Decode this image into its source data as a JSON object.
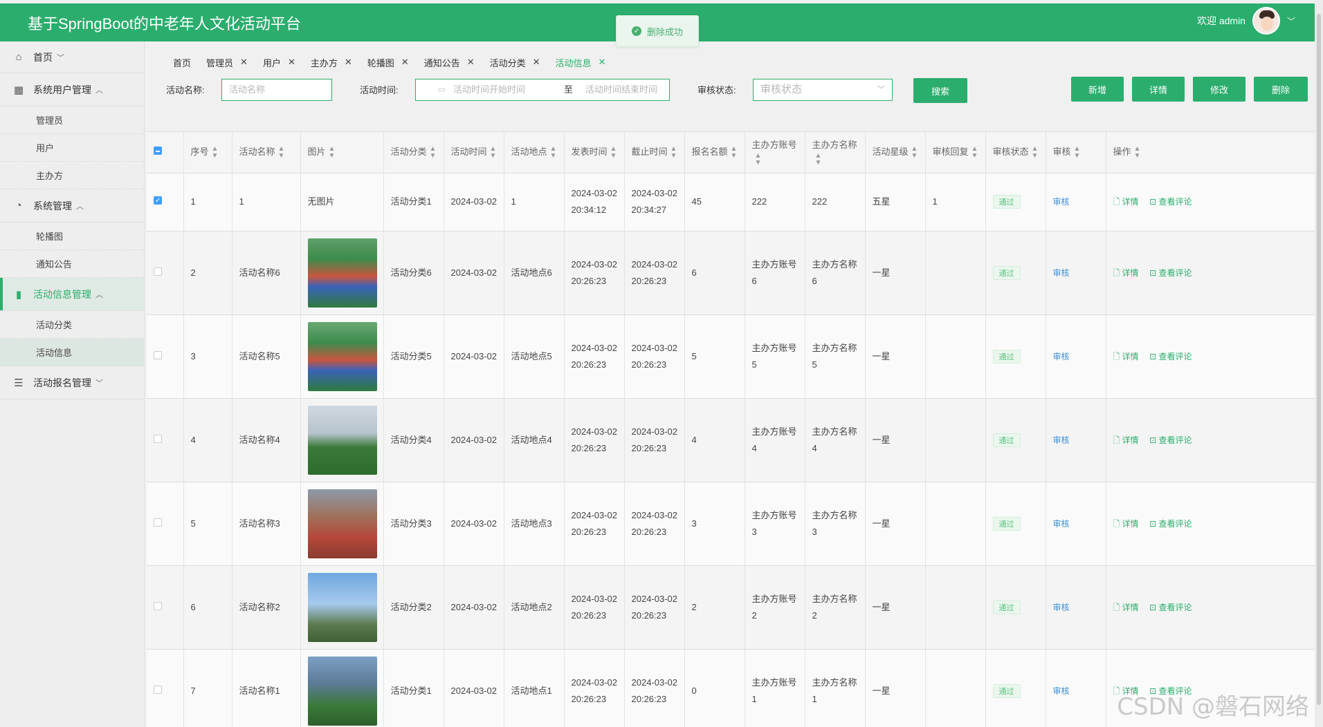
{
  "header": {
    "title": "基于SpringBoot的中老年人文化活动平台",
    "welcome": "欢迎 admin",
    "toast": "删除成功"
  },
  "sidebar": {
    "groups": [
      {
        "label": "首页",
        "icon": "home-icon"
      },
      {
        "label": "系统用户管理",
        "icon": "grid-icon",
        "items": [
          "管理员",
          "用户",
          "主办方"
        ]
      },
      {
        "label": "系统管理",
        "icon": "gauge-icon",
        "items": [
          "轮播图",
          "通知公告"
        ]
      },
      {
        "label": "活动信息管理",
        "icon": "folder-icon",
        "items": [
          "活动分类",
          "活动信息"
        ]
      },
      {
        "label": "活动报名管理",
        "icon": "server-icon"
      }
    ]
  },
  "tabs": [
    "首页",
    "管理员",
    "用户",
    "主办方",
    "轮播图",
    "通知公告",
    "活动分类",
    "活动信息"
  ],
  "filter": {
    "name_label": "活动名称:",
    "name_placeholder": "活动名称",
    "time_label": "活动时间:",
    "time_start_placeholder": "活动时间开始时间",
    "time_sep": "至",
    "time_end_placeholder": "活动时间结束时间",
    "status_label": "审核状态:",
    "status_placeholder": "审核状态",
    "search_btn": "搜索"
  },
  "actions": {
    "add": "新增",
    "detail": "详情",
    "edit": "修改",
    "delete": "删除"
  },
  "table": {
    "columns": [
      "序号",
      "活动名称",
      "图片",
      "活动分类",
      "活动时间",
      "活动地点",
      "发表时间",
      "截止时间",
      "报名名额",
      "主办方账号",
      "主办方名称",
      "活动星级",
      "审核回复",
      "审核状态",
      "审核",
      "操作"
    ],
    "audit_link": "审核",
    "op_detail": "详情",
    "op_comment": "查看评论",
    "rows": [
      {
        "no": "1",
        "name": "1",
        "image": "无图片",
        "category": "活动分类1",
        "time": "2024-03-02",
        "place": "1",
        "publish": "2024-03-02 20:34:12",
        "deadline": "2024-03-02 20:34:27",
        "quota": "45",
        "org_acc": "222",
        "org_name": "222",
        "stars": "五星",
        "reply": "1",
        "status": "通过"
      },
      {
        "no": "2",
        "name": "活动名称6",
        "image": "",
        "category": "活动分类6",
        "time": "2024-03-02",
        "place": "活动地点6",
        "publish": "2024-03-02 20:26:23",
        "deadline": "2024-03-02 20:26:23",
        "quota": "6",
        "org_acc": "主办方账号6",
        "org_name": "主办方名称6",
        "stars": "一星",
        "reply": "",
        "status": "通过"
      },
      {
        "no": "3",
        "name": "活动名称5",
        "image": "",
        "category": "活动分类5",
        "time": "2024-03-02",
        "place": "活动地点5",
        "publish": "2024-03-02 20:26:23",
        "deadline": "2024-03-02 20:26:23",
        "quota": "5",
        "org_acc": "主办方账号5",
        "org_name": "主办方名称5",
        "stars": "一星",
        "reply": "",
        "status": "通过"
      },
      {
        "no": "4",
        "name": "活动名称4",
        "image": "",
        "category": "活动分类4",
        "time": "2024-03-02",
        "place": "活动地点4",
        "publish": "2024-03-02 20:26:23",
        "deadline": "2024-03-02 20:26:23",
        "quota": "4",
        "org_acc": "主办方账号4",
        "org_name": "主办方名称4",
        "stars": "一星",
        "reply": "",
        "status": "通过"
      },
      {
        "no": "5",
        "name": "活动名称3",
        "image": "",
        "category": "活动分类3",
        "time": "2024-03-02",
        "place": "活动地点3",
        "publish": "2024-03-02 20:26:23",
        "deadline": "2024-03-02 20:26:23",
        "quota": "3",
        "org_acc": "主办方账号3",
        "org_name": "主办方名称3",
        "stars": "一星",
        "reply": "",
        "status": "通过"
      },
      {
        "no": "6",
        "name": "活动名称2",
        "image": "",
        "category": "活动分类2",
        "time": "2024-03-02",
        "place": "活动地点2",
        "publish": "2024-03-02 20:26:23",
        "deadline": "2024-03-02 20:26:23",
        "quota": "2",
        "org_acc": "主办方账号2",
        "org_name": "主办方名称2",
        "stars": "一星",
        "reply": "",
        "status": "通过"
      },
      {
        "no": "7",
        "name": "活动名称1",
        "image": "",
        "category": "活动分类1",
        "time": "2024-03-02",
        "place": "活动地点1",
        "publish": "2024-03-02 20:26:23",
        "deadline": "2024-03-02 20:26:23",
        "quota": "0",
        "org_acc": "主办方账号1",
        "org_name": "主办方名称1",
        "stars": "一星",
        "reply": "",
        "status": "通过"
      }
    ]
  },
  "watermark": "CSDN @磐石网络",
  "colors": {
    "primary": "#2bad6d",
    "link": "#3a8fd9",
    "checkbox": "#409eff"
  }
}
